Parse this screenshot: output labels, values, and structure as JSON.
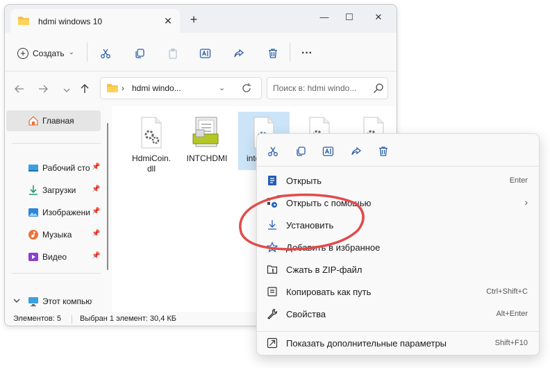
{
  "window": {
    "tab_title": "hdmi windows 10",
    "tab_close": "✕",
    "new_tab": "+",
    "minimize": "—",
    "maximize": "☐",
    "close": "✕"
  },
  "toolbar": {
    "create_label": "Создать",
    "create_chevron": "⌄",
    "more": "···"
  },
  "address": {
    "path_text": "hdmi windo...",
    "chevron": "›",
    "dropdown": "⌄"
  },
  "search": {
    "placeholder": "Поиск в: hdmi windo..."
  },
  "sidebar": {
    "home": "Главная",
    "items": [
      {
        "label": "Рабочий сто",
        "icon": "desktop-icon"
      },
      {
        "label": "Загрузки",
        "icon": "download-icon"
      },
      {
        "label": "Изображени",
        "icon": "pictures-icon"
      },
      {
        "label": "Музыка",
        "icon": "music-icon"
      },
      {
        "label": "Видео",
        "icon": "video-icon"
      }
    ],
    "computer": "Этот компьюте"
  },
  "files": [
    {
      "name_line1": "HdmiCoin.",
      "name_line2": "dll"
    },
    {
      "name_line1": "INTCHDMI",
      "name_line2": ""
    },
    {
      "name_line1": "intc",
      "name_line2": ""
    }
  ],
  "status": {
    "count": "Элементов: 5",
    "selected": "Выбран 1 элемент: 30,4 КБ"
  },
  "context_menu": {
    "items": [
      {
        "label": "Открыть",
        "shortcut": "Enter"
      },
      {
        "label": "Открыть с помощью",
        "shortcut": "›"
      },
      {
        "label": "Установить",
        "shortcut": ""
      },
      {
        "label": "Добавить в избранное",
        "shortcut": ""
      },
      {
        "label": "Сжать в ZIP-файл",
        "shortcut": ""
      },
      {
        "label": "Копировать как путь",
        "shortcut": "Ctrl+Shift+C"
      },
      {
        "label": "Свойства",
        "shortcut": "Alt+Enter"
      },
      {
        "label": "Показать дополнительные параметры",
        "shortcut": "Shift+F10"
      }
    ]
  },
  "colors": {
    "accent": "#0067c0",
    "highlight_circle": "#e24b4b",
    "selection": "#cce4f7"
  }
}
